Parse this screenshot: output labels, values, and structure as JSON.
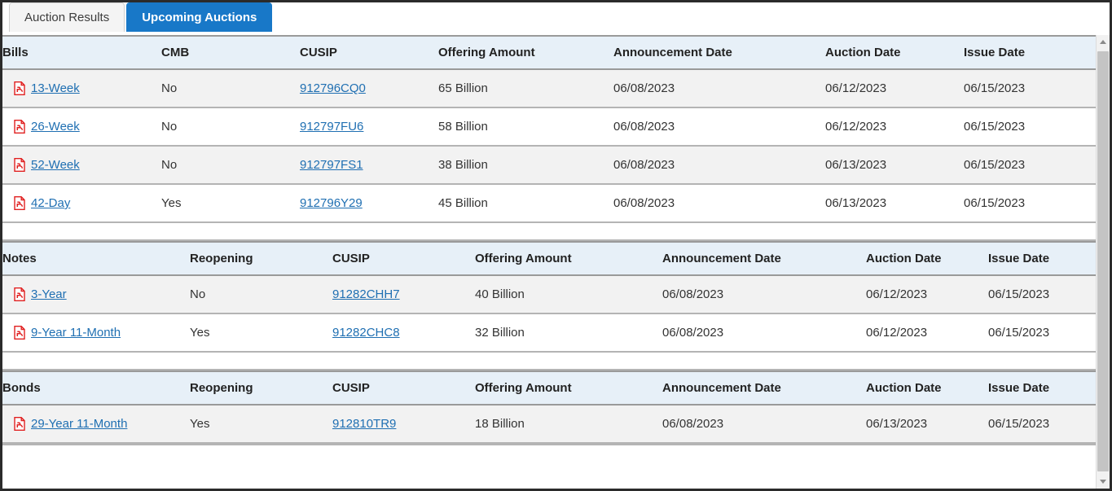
{
  "tabs": [
    {
      "label": "Auction Results",
      "active": false
    },
    {
      "label": "Upcoming Auctions",
      "active": true
    }
  ],
  "colors": {
    "active_tab_bg": "#1878c8",
    "header_bg": "#e7f0f8",
    "link": "#1f6fb2",
    "pdf_icon": "#e02020",
    "stripe_row": "#f2f2f2",
    "border": "#b4b4b4"
  },
  "icons": {
    "pdf": "pdf-file-icon",
    "scroll_up": "scroll-up-arrow-icon",
    "scroll_down": "scroll-down-arrow-icon"
  },
  "sections": [
    {
      "id": "bills",
      "columns": [
        "Bills",
        "CMB",
        "CUSIP",
        "Offering Amount",
        "Announcement Date",
        "Auction Date",
        "Issue Date"
      ],
      "rows": [
        {
          "security": "13-Week",
          "flag": "No",
          "cusip": "912796CQ0",
          "offering_amount": "65 Billion",
          "announcement_date": "06/08/2023",
          "auction_date": "06/12/2023",
          "issue_date": "06/15/2023"
        },
        {
          "security": "26-Week",
          "flag": "No",
          "cusip": "912797FU6",
          "offering_amount": "58 Billion",
          "announcement_date": "06/08/2023",
          "auction_date": "06/12/2023",
          "issue_date": "06/15/2023"
        },
        {
          "security": "52-Week",
          "flag": "No",
          "cusip": "912797FS1",
          "offering_amount": "38 Billion",
          "announcement_date": "06/08/2023",
          "auction_date": "06/13/2023",
          "issue_date": "06/15/2023"
        },
        {
          "security": "42-Day",
          "flag": "Yes",
          "cusip": "912796Y29",
          "offering_amount": "45 Billion",
          "announcement_date": "06/08/2023",
          "auction_date": "06/13/2023",
          "issue_date": "06/15/2023"
        }
      ]
    },
    {
      "id": "notes",
      "columns": [
        "Notes",
        "Reopening",
        "CUSIP",
        "Offering Amount",
        "Announcement Date",
        "Auction Date",
        "Issue Date"
      ],
      "rows": [
        {
          "security": "3-Year",
          "flag": "No",
          "cusip": "91282CHH7",
          "offering_amount": "40 Billion",
          "announcement_date": "06/08/2023",
          "auction_date": "06/12/2023",
          "issue_date": "06/15/2023"
        },
        {
          "security": "9-Year 11-Month",
          "flag": "Yes",
          "cusip": "91282CHC8",
          "offering_amount": "32 Billion",
          "announcement_date": "06/08/2023",
          "auction_date": "06/12/2023",
          "issue_date": "06/15/2023"
        }
      ]
    },
    {
      "id": "bonds",
      "columns": [
        "Bonds",
        "Reopening",
        "CUSIP",
        "Offering Amount",
        "Announcement Date",
        "Auction Date",
        "Issue Date"
      ],
      "rows": [
        {
          "security": "29-Year 11-Month",
          "flag": "Yes",
          "cusip": "912810TR9",
          "offering_amount": "18 Billion",
          "announcement_date": "06/08/2023",
          "auction_date": "06/13/2023",
          "issue_date": "06/15/2023"
        }
      ]
    }
  ]
}
